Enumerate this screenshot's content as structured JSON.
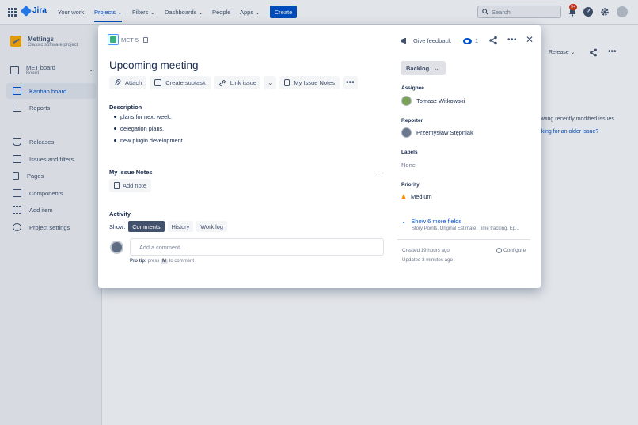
{
  "topnav": {
    "product": "Jira",
    "items": [
      "Your work",
      "Projects",
      "Filters",
      "Dashboards",
      "People",
      "Apps"
    ],
    "create_label": "Create",
    "search_placeholder": "Search",
    "notifications_badge": "9+"
  },
  "sidebar": {
    "project_name": "Mettings",
    "project_type": "Classic software project",
    "board_name": "MET board",
    "board_type": "Board",
    "items": [
      "Kanban board",
      "Reports",
      "Releases",
      "Issues and filters",
      "Pages",
      "Components",
      "Add item",
      "Project settings"
    ]
  },
  "background": {
    "release_label": "Release",
    "info_text": "owing recently modified issues.",
    "info_link": "oking for an older issue?"
  },
  "issue": {
    "key": "MET-5",
    "title": "Upcoming meeting",
    "toolbar": {
      "attach": "Attach",
      "create_subtask": "Create subtask",
      "link_issue": "Link issue",
      "my_issue_notes": "My Issue Notes"
    },
    "description_heading": "Description",
    "description_items": [
      "plans for next week.",
      "delegation plans.",
      "new plugin development."
    ],
    "notes_heading": "My Issue Notes",
    "add_note_label": "Add note",
    "activity_heading": "Activity",
    "show_label": "Show:",
    "activity_tabs": [
      "Comments",
      "History",
      "Work log"
    ],
    "comment_placeholder": "Add a comment...",
    "protip_label": "Pro tip:",
    "protip_press": "press",
    "protip_key": "M",
    "protip_suffix": "to comment"
  },
  "details": {
    "give_feedback": "Give feedback",
    "watchers_count": "1",
    "status": "Backlog",
    "assignee_label": "Assignee",
    "assignee": "Tomasz Witkowski",
    "reporter_label": "Reporter",
    "reporter": "Przemysław Stępniak",
    "labels_label": "Labels",
    "labels_value": "None",
    "priority_label": "Priority",
    "priority": "Medium",
    "show_more": "Show 6 more fields",
    "show_more_sub": "Story Points, Original Estimate, Time tracking, Ep...",
    "created": "Created 19 hours ago",
    "updated": "Updated 3 minutes ago",
    "configure": "Configure"
  },
  "colors": {
    "accent": "#0052cc",
    "story": "#36b37e",
    "priority_medium": "#ff8b00",
    "badge": "#de350b"
  }
}
